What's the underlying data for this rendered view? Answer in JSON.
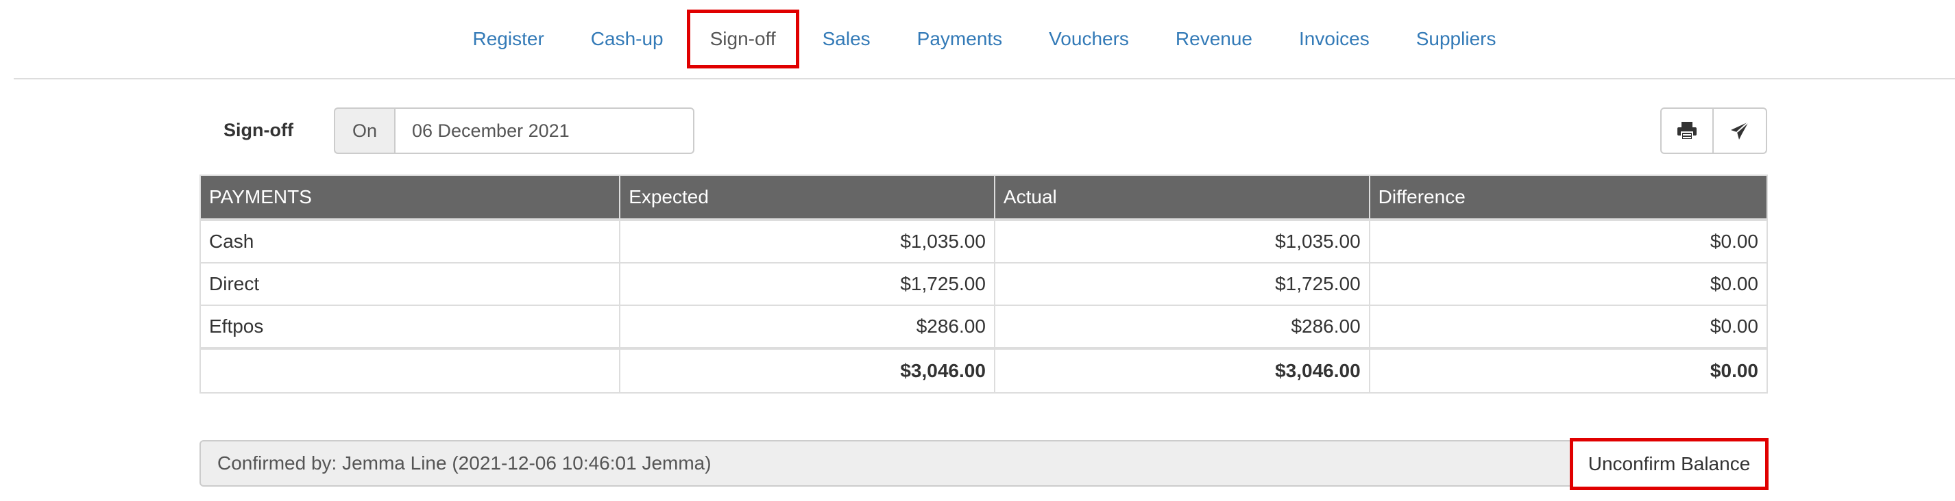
{
  "nav": {
    "tabs": [
      {
        "label": "Register",
        "active": false
      },
      {
        "label": "Cash-up",
        "active": false
      },
      {
        "label": "Sign-off",
        "active": true
      },
      {
        "label": "Sales",
        "active": false
      },
      {
        "label": "Payments",
        "active": false
      },
      {
        "label": "Vouchers",
        "active": false
      },
      {
        "label": "Revenue",
        "active": false
      },
      {
        "label": "Invoices",
        "active": false
      },
      {
        "label": "Suppliers",
        "active": false
      }
    ]
  },
  "signoff": {
    "label": "Sign-off",
    "date_addon": "On",
    "date_value": "06 December 2021",
    "print_icon": "print-icon",
    "send_icon": "paper-plane-icon"
  },
  "table": {
    "headers": [
      "PAYMENTS",
      "Expected",
      "Actual",
      "Difference"
    ],
    "rows": [
      {
        "method": "Cash",
        "expected": "$1,035.00",
        "actual": "$1,035.00",
        "difference": "$0.00"
      },
      {
        "method": "Direct",
        "expected": "$1,725.00",
        "actual": "$1,725.00",
        "difference": "$0.00"
      },
      {
        "method": "Eftpos",
        "expected": "$286.00",
        "actual": "$286.00",
        "difference": "$0.00"
      }
    ],
    "total": {
      "method": "",
      "expected": "$3,046.00",
      "actual": "$3,046.00",
      "difference": "$0.00"
    }
  },
  "confirmation": {
    "text": "Confirmed by: Jemma Line (2021-12-06 10:46:01 Jemma)",
    "button_label": "Unconfirm Balance"
  },
  "colors": {
    "link": "#337ab7",
    "header_bg": "#666666",
    "highlight": "#e00000"
  }
}
